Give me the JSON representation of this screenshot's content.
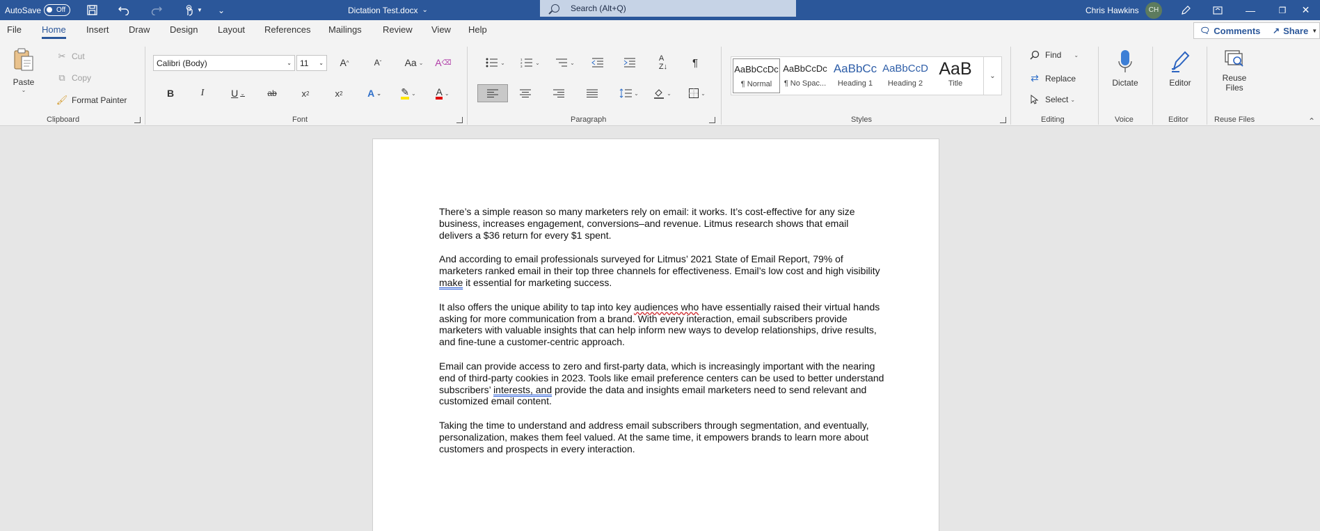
{
  "titlebar": {
    "autosave_label": "AutoSave",
    "autosave_state": "Off",
    "doc_title": "Dictation Test.docx",
    "search_placeholder": "Search (Alt+Q)",
    "user_name": "Chris Hawkins",
    "user_initials": "CH"
  },
  "menu": {
    "tabs": [
      "File",
      "Home",
      "Insert",
      "Draw",
      "Design",
      "Layout",
      "References",
      "Mailings",
      "Review",
      "View",
      "Help"
    ],
    "active": "Home",
    "comments_label": "Comments",
    "share_label": "Share"
  },
  "ribbon": {
    "clipboard": {
      "label": "Clipboard",
      "paste": "Paste",
      "cut": "Cut",
      "copy": "Copy",
      "format_painter": "Format Painter"
    },
    "font": {
      "label": "Font",
      "font_name": "Calibri (Body)",
      "font_size": "11"
    },
    "paragraph": {
      "label": "Paragraph"
    },
    "styles": {
      "label": "Styles",
      "items": [
        {
          "sample": "AaBbCcDc",
          "name": "¶ Normal"
        },
        {
          "sample": "AaBbCcDc",
          "name": "¶ No Spac..."
        },
        {
          "sample": "AaBbCc",
          "name": "Heading 1"
        },
        {
          "sample": "AaBbCcD",
          "name": "Heading 2"
        },
        {
          "sample": "AaB",
          "name": "Title"
        }
      ]
    },
    "editing": {
      "label": "Editing",
      "find": "Find",
      "replace": "Replace",
      "select": "Select"
    },
    "voice": {
      "label": "Voice",
      "dictate": "Dictate"
    },
    "editor": {
      "label": "Editor",
      "editor": "Editor"
    },
    "reuse": {
      "label": "Reuse Files",
      "line1": "Reuse",
      "line2": "Files"
    }
  },
  "document": {
    "p1": "There’s a simple reason so many marketers rely on email: it works. It’s cost-effective for any size business, increases engagement, conversions–and revenue. Litmus research shows that email delivers a $36 return for every $1 spent.",
    "p2a": "And according to email professionals surveyed for Litmus’ 2021 State of Email Report, 79% of marketers ranked email in their top three channels for effectiveness. Email’s low cost and high visibility ",
    "p2b": "make",
    "p2c": " it essential for marketing success.",
    "p3a": "It also offers the unique ability to tap into key ",
    "p3b": "audiences who",
    "p3c": " have essentially raised their virtual hands asking for more communication from a brand. With every interaction, email subscribers provide marketers with valuable insights that can help inform new ways to develop relationships, drive results, and fine-tune a customer-centric approach.",
    "p4a": "Email can provide access to zero and first-party data, which is increasingly important with the nearing end of third-party cookies in 2023. Tools like email preference centers can be used to better understand subscribers’ ",
    "p4b": "interests, and",
    "p4c": " provide the data and insights email marketers need to send relevant and customized email content.",
    "p5": "Taking the time to understand and address email subscribers through segmentation, and eventually, personalization, makes them feel valued. At the same time, it empowers brands to learn more about customers and prospects in every interaction."
  }
}
